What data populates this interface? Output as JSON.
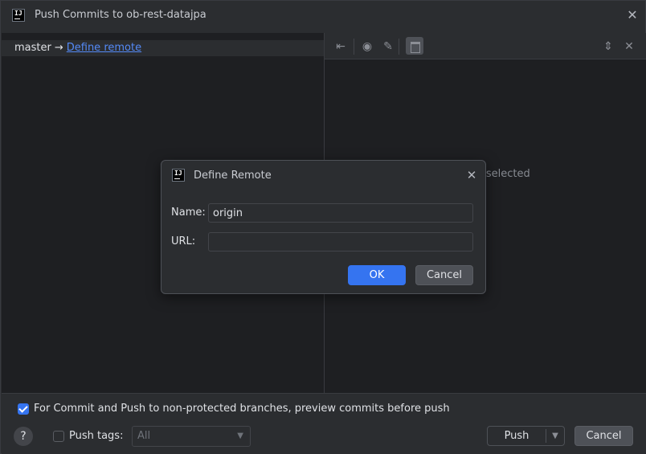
{
  "window": {
    "title": "Push Commits to ob-rest-datajpa"
  },
  "left": {
    "branch": "master",
    "arrow": "→",
    "remote_link": "Define remote"
  },
  "right": {
    "empty_text": "s selected"
  },
  "bottom": {
    "preview_checkbox_checked": true,
    "preview_label": "For Commit and Push to non-protected branches, preview commits before push",
    "help_label": "?",
    "push_tags_checked": false,
    "push_tags_label": "Push tags:",
    "tags_select_value": "All",
    "push_button": "Push",
    "cancel_button": "Cancel"
  },
  "dialog": {
    "title": "Define Remote",
    "name_label": "Name:",
    "name_value": "origin",
    "url_label": "URL:",
    "url_value": "",
    "ok_button": "OK",
    "cancel_button": "Cancel"
  },
  "colors": {
    "accent": "#3574f0",
    "link": "#548af7",
    "background": "#2b2d30",
    "panel": "#1e1f22"
  }
}
